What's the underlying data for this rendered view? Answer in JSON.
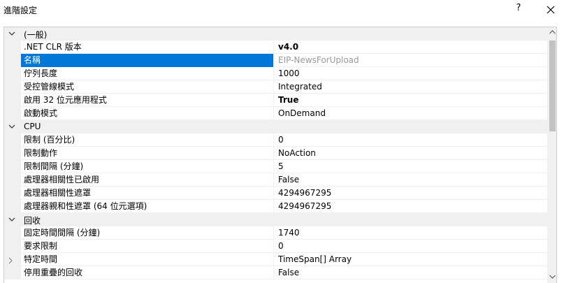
{
  "window": {
    "title": "進階設定",
    "help_label": "?"
  },
  "grid": {
    "categories": [
      {
        "label": "(一般)",
        "properties": [
          {
            "name": ".NET CLR 版本",
            "value": "v4.0",
            "bold": true
          },
          {
            "name": "名稱",
            "value": "EIP-NewsForUpload",
            "selected": true,
            "readonly": true
          },
          {
            "name": "佇列長度",
            "value": "1000"
          },
          {
            "name": "受控管線模式",
            "value": "Integrated"
          },
          {
            "name": "啟用 32 位元應用程式",
            "value": "True",
            "bold": true
          },
          {
            "name": "啟動模式",
            "value": "OnDemand"
          }
        ]
      },
      {
        "label": "CPU",
        "properties": [
          {
            "name": "限制 (百分比)",
            "value": "0"
          },
          {
            "name": "限制動作",
            "value": "NoAction"
          },
          {
            "name": "限制間隔 (分鐘)",
            "value": "5"
          },
          {
            "name": "處理器相關性已啟用",
            "value": "False"
          },
          {
            "name": "處理器相關性遮罩",
            "value": "4294967295"
          },
          {
            "name": "處理器親和性遮罩 (64 位元選項)",
            "value": "4294967295"
          }
        ]
      },
      {
        "label": "回收",
        "properties": [
          {
            "name": "固定時間間隔 (分鐘)",
            "value": "1740"
          },
          {
            "name": "要求限制",
            "value": "0"
          },
          {
            "name": "特定時間",
            "value": "TimeSpan[] Array",
            "expandable": true
          },
          {
            "name": "停用重疊的回收",
            "value": "False"
          }
        ]
      }
    ]
  },
  "colors": {
    "selection": "#0078d7",
    "category_bg": "#f0f0f0",
    "readonly_text": "#9a9a9a"
  }
}
